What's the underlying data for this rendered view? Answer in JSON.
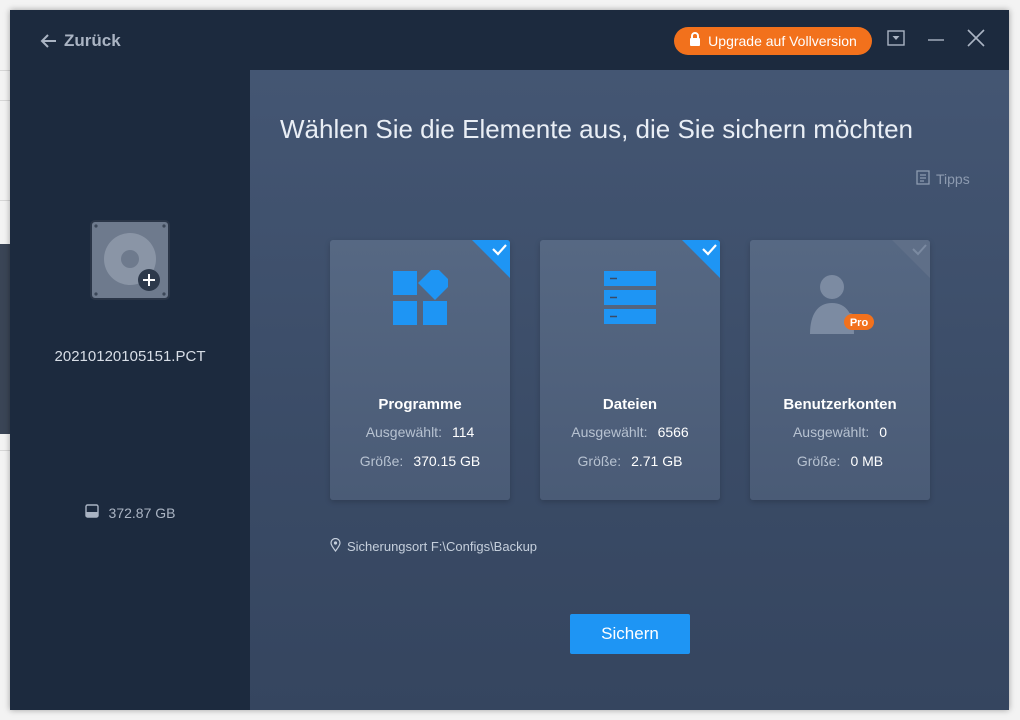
{
  "header": {
    "back_label": "Zurück",
    "upgrade_label": "Upgrade auf Vollversion"
  },
  "source": {
    "image_name": "20210120105151.PCT",
    "disk_size": "372.87 GB"
  },
  "main": {
    "title": "Wählen Sie die Elemente aus, die Sie sichern möchten",
    "tips_label": "Tipps",
    "selected_label": "Ausgewählt:",
    "size_label": "Größe:",
    "cards": [
      {
        "title": "Programme",
        "selected": "114",
        "size": "370.15 GB",
        "checked": true,
        "icon": "apps-icon"
      },
      {
        "title": "Dateien",
        "selected": "6566",
        "size": "2.71 GB",
        "checked": true,
        "icon": "files-icon"
      },
      {
        "title": "Benutzerkonten",
        "selected": "0",
        "size": "0 MB",
        "checked": false,
        "icon": "user-accounts-icon",
        "badge": "Pro"
      }
    ],
    "location_text": "Sicherungsort F:\\Configs\\Backup",
    "save_label": "Sichern"
  },
  "colors": {
    "accent": "#1e95f4",
    "upgrade": "#f2711c",
    "window_bg": "#1c2a3e"
  }
}
